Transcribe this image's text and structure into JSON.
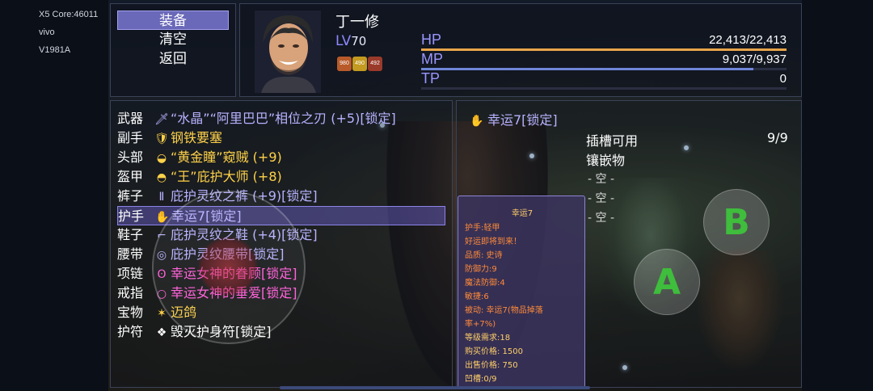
{
  "device": {
    "core": "X5 Core:46011",
    "brand": "vivo",
    "model": "V1981A"
  },
  "menu": {
    "items": [
      "装备",
      "清空",
      "返回"
    ],
    "active_index": 0
  },
  "character": {
    "name": "丁一修",
    "level_label": "LV",
    "level": "70",
    "buffs": [
      "980",
      "490",
      "492"
    ],
    "stats": {
      "hp": {
        "label": "HP",
        "value": "22,413/22,413",
        "fill": 1.0,
        "color": "#e8a44a"
      },
      "mp": {
        "label": "MP",
        "value": "9,037/9,937",
        "fill": 0.909,
        "color": "#6f86d8"
      },
      "tp": {
        "label": "TP",
        "value": "0",
        "fill": 0.0,
        "color": "#7a68c8"
      }
    }
  },
  "equipment": {
    "selected_index": 5,
    "rows": [
      {
        "slot": "武器",
        "icon": "sword-icon",
        "glyph": "🗡",
        "name": "“水晶”“阿里巴巴”相位之刃 (+5)[锁定]",
        "tone": "violet"
      },
      {
        "slot": "副手",
        "icon": "fortress-icon",
        "glyph": "🛡",
        "name": "钢铁要塞",
        "tone": "gold"
      },
      {
        "slot": "头部",
        "icon": "mask-icon",
        "glyph": "◒",
        "name": "“黄金瞳”窥贼 (+9)",
        "tone": "gold"
      },
      {
        "slot": "盔甲",
        "icon": "armor-icon",
        "glyph": "◓",
        "name": "“王”庇护大师 (+8)",
        "tone": "gold"
      },
      {
        "slot": "裤子",
        "icon": "pants-icon",
        "glyph": "Ⅱ",
        "name": "庇护灵纹之裤 (+9)[锁定]",
        "tone": "violet"
      },
      {
        "slot": "护手",
        "icon": "gauntlet-icon",
        "glyph": "✋",
        "name": "幸运7[锁定]",
        "tone": "violet"
      },
      {
        "slot": "鞋子",
        "icon": "boots-icon",
        "glyph": "⌐",
        "name": "庇护灵纹之鞋 (+4)[锁定]",
        "tone": "violet"
      },
      {
        "slot": "腰带",
        "icon": "belt-icon",
        "glyph": "◎",
        "name": "庇护灵纹腰带[锁定]",
        "tone": "violet"
      },
      {
        "slot": "项链",
        "icon": "necklace-icon",
        "glyph": "ʘ",
        "name": "幸运女神的眷顾[锁定]",
        "tone": "pink"
      },
      {
        "slot": "戒指",
        "icon": "ring-icon",
        "glyph": "○",
        "name": "幸运女神的垂爱[锁定]",
        "tone": "pink"
      },
      {
        "slot": "宝物",
        "icon": "treasure-icon",
        "glyph": "✶",
        "name": "迈鸽",
        "tone": "gold"
      },
      {
        "slot": "护符",
        "icon": "talisman-icon",
        "glyph": "❖",
        "name": "毁灭护身符[锁定]",
        "tone": "white"
      }
    ]
  },
  "socket": {
    "item_name": "幸运7[锁定]",
    "header": "插槽可用",
    "count": "9/9",
    "label": "镶嵌物",
    "slots": [
      "- 空 -",
      "- 空 -",
      "- 空 -"
    ]
  },
  "tooltip": {
    "title": "幸运7",
    "lines": [
      {
        "text": "护手:轻甲",
        "color": "#ff8a3a"
      },
      {
        "text": "好运即将到来！",
        "color": "#ff8a3a"
      },
      {
        "text": "品质: 史诗",
        "color": "#ff8a3a"
      },
      {
        "text": "防御力:9",
        "color": "#ff8a3a"
      },
      {
        "text": "魔法防御:4",
        "color": "#ff8a3a"
      },
      {
        "text": "敏捷:6",
        "color": "#ff8a3a"
      },
      {
        "text": "被动: 幸运7(物品掉落",
        "color": "#ff8a3a"
      },
      {
        "text": "率+7%)",
        "color": "#ff8a3a"
      },
      {
        "text": "等级需求:18",
        "color": "#ffcf6a"
      },
      {
        "text": "购买价格: 1500",
        "color": "#ffcf6a"
      },
      {
        "text": "出售价格: 750",
        "color": "#ffcf6a"
      },
      {
        "text": "凹槽:0/9",
        "color": "#ffcf6a"
      }
    ]
  },
  "controls": {
    "button_b": "B",
    "button_a": "A"
  },
  "tones": {
    "violet": "#b8b2ff",
    "gold": "#ffd24a",
    "pink": "#ff5cd8",
    "white": "#ffffff"
  }
}
